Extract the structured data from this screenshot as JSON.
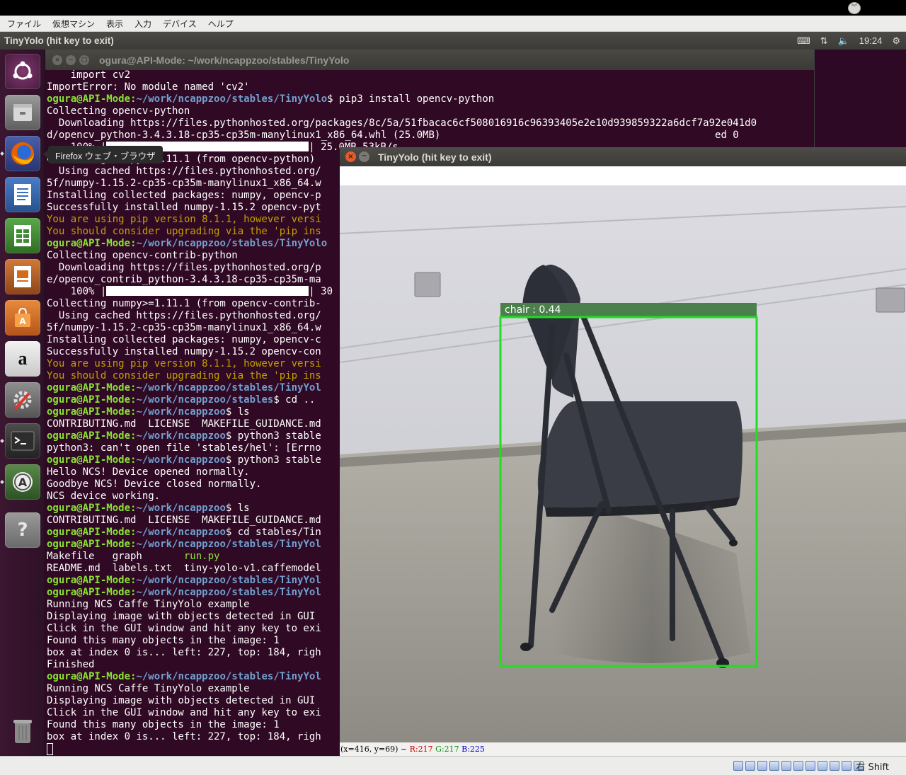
{
  "vbox_menu": [
    "ファイル",
    "仮想マシン",
    "表示",
    "入力",
    "デバイス",
    "ヘルプ"
  ],
  "topbar": {
    "title": "TinyYolo (hit key to exit)",
    "time": "19:24"
  },
  "launcher": {
    "items": [
      "ubuntu-dash",
      "files",
      "firefox",
      "writer",
      "calc",
      "impress",
      "software-center",
      "amazon",
      "system-settings",
      "terminal",
      "software-updater",
      "unknown-app",
      "trash"
    ],
    "tooltip": "Firefox ウェブ・ブラウザ"
  },
  "terminal": {
    "title": "ogura@API-Mode: ~/work/ncappzoo/stables/TinyYolo",
    "prompt_user": "ogura@API-Mode",
    "lines": [
      {
        "t": "plain",
        "v": "    import cv2"
      },
      {
        "t": "plain",
        "v": "ImportError: No module named 'cv2'"
      },
      {
        "t": "prompt",
        "p": "~/work/ncappzoo/stables/TinyYolo",
        "v": "$ pip3 install opencv-python"
      },
      {
        "t": "plain",
        "v": "Collecting opencv-python"
      },
      {
        "t": "plain",
        "v": "  Downloading https://files.pythonhosted.org/packages/8c/5a/51fbacac6cf508016916c96393405e2e10d939859322a6dcf7a92e041d0"
      },
      {
        "t": "plain",
        "v": "d/opencv_python-3.4.3.18-cp35-cp35m-manylinux1_x86_64.whl (25.0MB)                                              ed 0"
      },
      {
        "t": "bar",
        "pre": "    100% |",
        "post": "| 25.0MB 53kB/s"
      },
      {
        "t": "plain",
        "v": "Collecting numpy>=1.11.1 (from opencv-python)"
      },
      {
        "t": "plain",
        "v": "  Using cached https://files.pythonhosted.org/"
      },
      {
        "t": "plain",
        "v": "5f/numpy-1.15.2-cp35-cp35m-manylinux1_x86_64.w"
      },
      {
        "t": "plain",
        "v": "Installing collected packages: numpy, opencv-p"
      },
      {
        "t": "plain",
        "v": "Successfully installed numpy-1.15.2 opencv-pyt"
      },
      {
        "t": "yellow",
        "v": "You are using pip version 8.1.1, however versi"
      },
      {
        "t": "yellow",
        "v": "You should consider upgrading via the 'pip ins"
      },
      {
        "t": "prompt",
        "p": "~/work/ncappzoo/stables/TinyYolo",
        "v": ""
      },
      {
        "t": "plain",
        "v": "Collecting opencv-contrib-python"
      },
      {
        "t": "plain",
        "v": "  Downloading https://files.pythonhosted.org/p"
      },
      {
        "t": "plain",
        "v": "e/opencv_contrib_python-3.4.3.18-cp35-cp35m-ma"
      },
      {
        "t": "bar",
        "pre": "    100% |",
        "post": "| 30"
      },
      {
        "t": "plain",
        "v": "Collecting numpy>=1.11.1 (from opencv-contrib-"
      },
      {
        "t": "plain",
        "v": "  Using cached https://files.pythonhosted.org/"
      },
      {
        "t": "plain",
        "v": "5f/numpy-1.15.2-cp35-cp35m-manylinux1_x86_64.w"
      },
      {
        "t": "plain",
        "v": "Installing collected packages: numpy, opencv-c"
      },
      {
        "t": "plain",
        "v": "Successfully installed numpy-1.15.2 opencv-con"
      },
      {
        "t": "yellow",
        "v": "You are using pip version 8.1.1, however versi"
      },
      {
        "t": "yellow",
        "v": "You should consider upgrading via the 'pip ins"
      },
      {
        "t": "prompt",
        "p": "~/work/ncappzoo/stables/TinyYol",
        "v": ""
      },
      {
        "t": "prompt",
        "p": "~/work/ncappzoo/stables",
        "v": "$ cd .."
      },
      {
        "t": "prompt",
        "p": "~/work/ncappzoo",
        "v": "$ ls"
      },
      {
        "t": "plain",
        "v": "CONTRIBUTING.md  LICENSE  MAKEFILE_GUIDANCE.md"
      },
      {
        "t": "prompt",
        "p": "~/work/ncappzoo",
        "v": "$ python3 stable"
      },
      {
        "t": "plain",
        "v": "python3: can't open file 'stables/hel': [Errno"
      },
      {
        "t": "prompt",
        "p": "~/work/ncappzoo",
        "v": "$ python3 stable"
      },
      {
        "t": "plain",
        "v": "Hello NCS! Device opened normally."
      },
      {
        "t": "plain",
        "v": "Goodbye NCS! Device closed normally."
      },
      {
        "t": "plain",
        "v": "NCS device working."
      },
      {
        "t": "prompt",
        "p": "~/work/ncappzoo",
        "v": "$ ls"
      },
      {
        "t": "plain",
        "v": "CONTRIBUTING.md  LICENSE  MAKEFILE_GUIDANCE.md"
      },
      {
        "t": "prompt",
        "p": "~/work/ncappzoo",
        "v": "$ cd stables/Tin"
      },
      {
        "t": "prompt",
        "p": "~/work/ncappzoo/stables/TinyYol",
        "v": ""
      },
      {
        "t": "ls",
        "a": "Makefile   graph       ",
        "b": "run.py"
      },
      {
        "t": "plain",
        "v": "README.md  labels.txt  tiny-yolo-v1.caffemodel"
      },
      {
        "t": "prompt",
        "p": "~/work/ncappzoo/stables/TinyYol",
        "v": ""
      },
      {
        "t": "prompt",
        "p": "~/work/ncappzoo/stables/TinyYol",
        "v": ""
      },
      {
        "t": "plain",
        "v": "Running NCS Caffe TinyYolo example"
      },
      {
        "t": "plain",
        "v": "Displaying image with objects detected in GUI"
      },
      {
        "t": "plain",
        "v": "Click in the GUI window and hit any key to exi"
      },
      {
        "t": "plain",
        "v": "Found this many objects in the image: 1"
      },
      {
        "t": "plain",
        "v": "box at index 0 is... left: 227, top: 184, righ"
      },
      {
        "t": "plain",
        "v": "Finished"
      },
      {
        "t": "prompt",
        "p": "~/work/ncappzoo/stables/TinyYol",
        "v": ""
      },
      {
        "t": "plain",
        "v": "Running NCS Caffe TinyYolo example"
      },
      {
        "t": "plain",
        "v": "Displaying image with objects detected in GUI"
      },
      {
        "t": "plain",
        "v": "Click in the GUI window and hit any key to exi"
      },
      {
        "t": "plain",
        "v": "Found this many objects in the image: 1"
      },
      {
        "t": "plain",
        "v": "box at index 0 is... left: 227, top: 184, righ"
      }
    ]
  },
  "gui_window": {
    "title": "TinyYolo (hit key to exit)",
    "detection_label": "chair : 0.44",
    "status": {
      "coords": "(x=416, y=69) ~ ",
      "r": "R:217",
      "g": "G:217",
      "b": "B:225"
    }
  },
  "vbox_status": {
    "host_key": "右 Shift"
  },
  "colors": {
    "detection_box": "#22dd22",
    "label_bg": "#4b7f4b",
    "prompt_green": "#8ae234",
    "prompt_blue": "#729fcf",
    "warning_yellow": "#c4a000",
    "terminal_bg": "#300a24"
  }
}
